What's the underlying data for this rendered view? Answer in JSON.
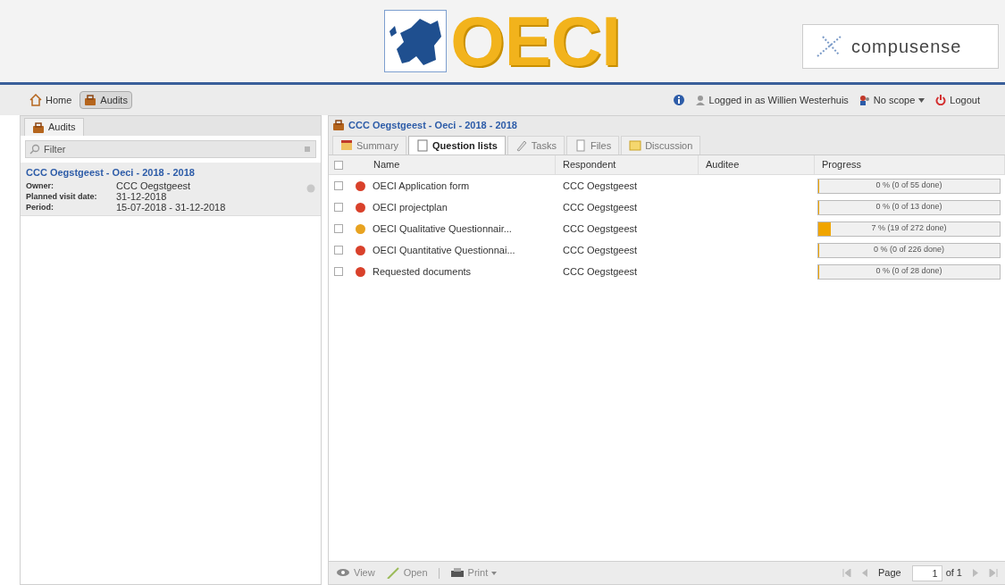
{
  "header": {
    "logo_text": "OECI",
    "partner_logo_text": "compusense"
  },
  "nav": {
    "items": [
      {
        "label": "Home",
        "selected": false
      },
      {
        "label": "Audits",
        "selected": true
      }
    ],
    "user": "Logged in as Willien Westerhuis",
    "scope": "No scope",
    "logout": "Logout"
  },
  "sidebar": {
    "tab": "Audits",
    "filter": {
      "placeholder": "Filter"
    },
    "audits": [
      {
        "title": "CCC Oegstgeest - Oeci - 2018 - 2018",
        "fields": [
          {
            "label": "Owner:",
            "value": "CCC Oegstgeest"
          },
          {
            "label": "Planned visit date:",
            "value": "31-12-2018"
          },
          {
            "label": "Period:",
            "value": "15-07-2018 - 31-12-2018"
          }
        ]
      }
    ]
  },
  "main": {
    "title": "CCC Oegstgeest - Oeci - 2018 - 2018",
    "tabs": [
      {
        "label": "Summary",
        "selected": false
      },
      {
        "label": "Question lists",
        "selected": true
      },
      {
        "label": "Tasks",
        "selected": false
      },
      {
        "label": "Files",
        "selected": false
      },
      {
        "label": "Discussion",
        "selected": false
      }
    ],
    "table": {
      "all_checked": false,
      "columns": [
        "Name",
        "Respondent",
        "Auditee",
        "Progress"
      ],
      "rows": [
        {
          "checked": false,
          "color": "#d9412b",
          "name": "OECI Application form",
          "respondent": "CCC Oegstgeest",
          "level": 0,
          "progress": "0 % (0 of 55 done)"
        },
        {
          "checked": false,
          "color": "#d9412b",
          "name": "OECI projectplan",
          "respondent": "CCC Oegstgeest",
          "level": 0,
          "progress": "0 % (0 of 13 done)"
        },
        {
          "checked": false,
          "color": "#e8a321",
          "name": "OECI Qualitative Questionnair...",
          "respondent": "CCC Oegstgeest",
          "level": 0.07,
          "progress": "7 % (19 of 272 done)"
        },
        {
          "checked": false,
          "color": "#d9412b",
          "name": "OECI Quantitative Questionnai...",
          "respondent": "CCC Oegstgeest",
          "level": 0,
          "progress": "0 % (0 of 226 done)"
        },
        {
          "checked": false,
          "color": "#d9412b",
          "name": "Requested documents",
          "respondent": "CCC Oegstgeest",
          "level": 0,
          "progress": "0 % (0 of 28 done)"
        }
      ]
    },
    "toolbar": {
      "buttons": [
        {
          "kind": "view",
          "label": "View"
        },
        {
          "kind": "open",
          "label": "Open"
        },
        {
          "kind": "print",
          "label": "Print"
        }
      ],
      "page_label": "Page",
      "page": "1",
      "page_total": "of 1"
    }
  }
}
